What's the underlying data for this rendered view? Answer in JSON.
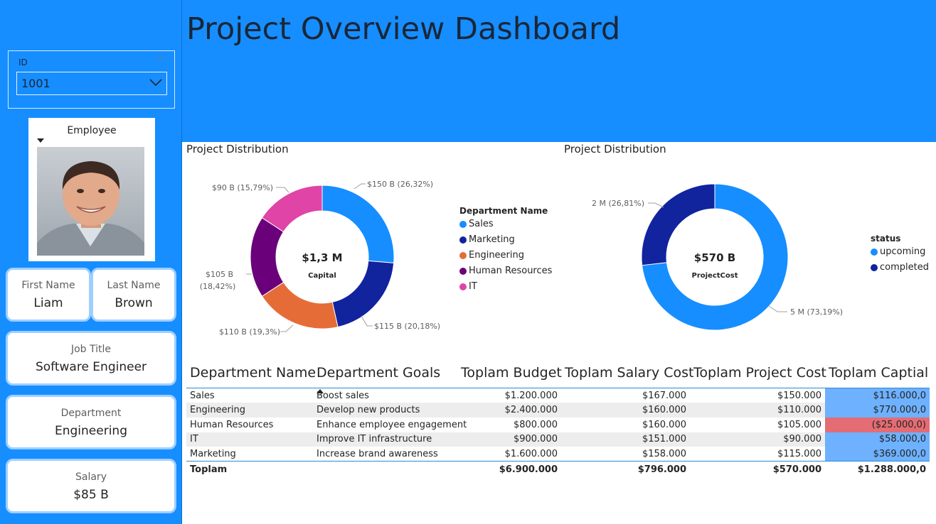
{
  "header": {
    "title": "Project Overview Dashboard"
  },
  "colors": {
    "accent": "#168eff",
    "card_border": "#9ecfff",
    "negative": "#e46c74",
    "positive_cell": "#6db1ff"
  },
  "filter": {
    "label": "ID",
    "value": "1001"
  },
  "employee": {
    "photo_caption": "Employee",
    "first_name_label": "First Name",
    "first_name": "Liam",
    "last_name_label": "Last Name",
    "last_name": "Brown",
    "job_title_label": "Job Title",
    "job_title": "Software Engineer",
    "department_label": "Department",
    "department": "Engineering",
    "salary_label": "Salary",
    "salary": "$85 B"
  },
  "chart_data": [
    {
      "type": "donut",
      "title": "Project Distribution",
      "center_value": "$1,3 M",
      "center_label": "Capital",
      "legend_title": "Department Name",
      "legend_position": "right",
      "slices": [
        {
          "name": "Sales",
          "value": 150,
          "label": "$150 B (26,32%)",
          "color": "#168eff"
        },
        {
          "name": "Marketing",
          "value": 115,
          "label": "$115 B (20,18%)",
          "color": "#12239e"
        },
        {
          "name": "Engineering",
          "value": 110,
          "label": "$110 B (19,3%)",
          "color": "#e66c37"
        },
        {
          "name": "Human Resources",
          "value": 105,
          "label": "$105 B (18,42%)",
          "color": "#6b007b"
        },
        {
          "name": "IT",
          "value": 90,
          "label": "$90 B (15,79%)",
          "color": "#e044a7"
        }
      ]
    },
    {
      "type": "donut",
      "title": "Project Distribution",
      "center_value": "$570 B",
      "center_label": "ProjectCost",
      "legend_title": "status",
      "legend_position": "right",
      "slices": [
        {
          "name": "upcoming",
          "value": 73.19,
          "label": "5 M (73,19%)",
          "color": "#168eff"
        },
        {
          "name": "completed",
          "value": 26.81,
          "label": "2 M (26,81%)",
          "color": "#12239e"
        }
      ]
    }
  ],
  "table": {
    "columns": [
      "Department Name",
      "Department Goals",
      "Toplam Budget",
      "Toplam Salary Cost",
      "Toplam Project Cost",
      "Toplam Captial"
    ],
    "rows": [
      {
        "dept": "Sales",
        "goal": "Boost sales",
        "budget": "$1.200.000",
        "salary": "$167.000",
        "project": "$150.000",
        "capital": "$116.000,0",
        "capital_negative": false
      },
      {
        "dept": "Engineering",
        "goal": "Develop new products",
        "budget": "$2.400.000",
        "salary": "$160.000",
        "project": "$110.000",
        "capital": "$770.000,0",
        "capital_negative": false
      },
      {
        "dept": "Human Resources",
        "goal": "Enhance employee engagement",
        "budget": "$800.000",
        "salary": "$160.000",
        "project": "$105.000",
        "capital": "($25.000,0)",
        "capital_negative": true
      },
      {
        "dept": "IT",
        "goal": "Improve IT infrastructure",
        "budget": "$900.000",
        "salary": "$151.000",
        "project": "$90.000",
        "capital": "$58.000,0",
        "capital_negative": false
      },
      {
        "dept": "Marketing",
        "goal": "Increase brand awareness",
        "budget": "$1.600.000",
        "salary": "$158.000",
        "project": "$115.000",
        "capital": "$369.000,0",
        "capital_negative": false
      }
    ],
    "total": {
      "label": "Toplam",
      "budget": "$6.900.000",
      "salary": "$796.000",
      "project": "$570.000",
      "capital": "$1.288.000,0"
    }
  }
}
